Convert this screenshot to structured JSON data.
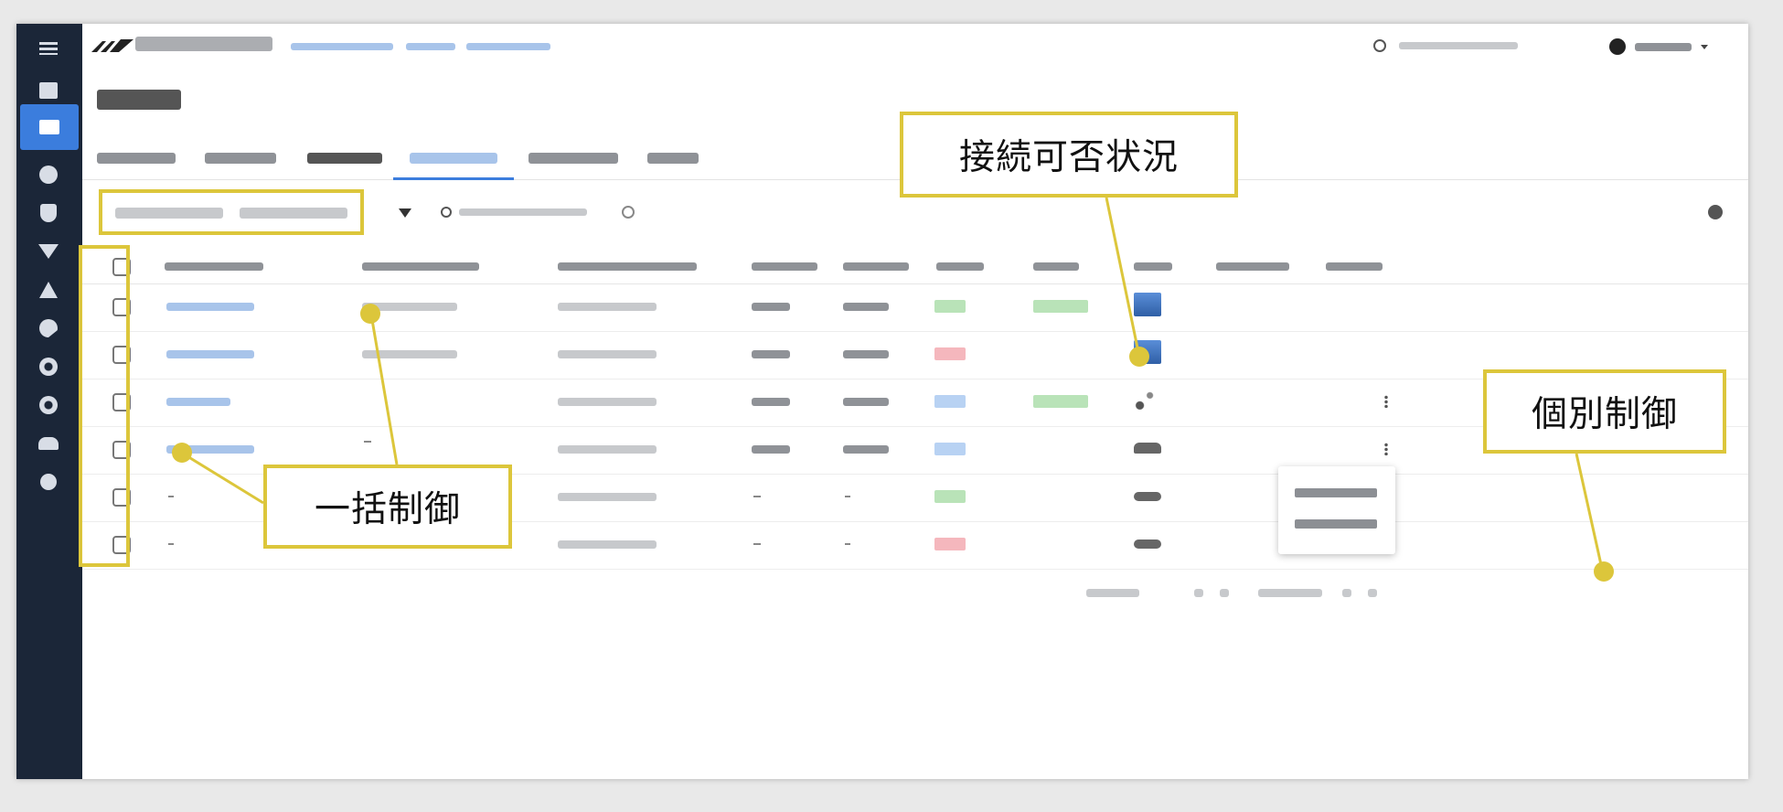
{
  "callouts": {
    "connection_status": "接続可否状況",
    "bulk_control": "一括制御",
    "individual_control": "個別制御"
  },
  "colors": {
    "sidebar_bg": "#1b2638",
    "accent": "#3b7ddd",
    "callout_border": "#dcc63b",
    "badge_green": "#b9e3b8",
    "badge_red": "#f5b7bd",
    "badge_blue": "#b8d2f3"
  },
  "icons": {
    "sidebar": [
      "menu-icon",
      "dashboard-icon",
      "asset-icon",
      "globe-icon",
      "shield-icon",
      "wifi-icon",
      "network-icon",
      "chart-icon",
      "security-icon",
      "settings-icon",
      "cloud-icon",
      "device-icon"
    ],
    "topbar": [
      "search-icon",
      "user-icon",
      "chevron-down-icon"
    ],
    "toolbar": [
      "filter-icon",
      "search-icon",
      "settings-icon"
    ]
  },
  "table": {
    "rows": [
      {
        "status": "green",
        "approval": "green",
        "device": "laptop"
      },
      {
        "status": "red",
        "approval": "",
        "device": "laptop"
      },
      {
        "status": "blue",
        "approval": "green",
        "device": "iot"
      },
      {
        "status": "blue",
        "approval": "",
        "device": "router"
      },
      {
        "status": "green",
        "approval": "",
        "device": "router"
      },
      {
        "status": "red",
        "approval": "",
        "device": "router"
      }
    ]
  }
}
